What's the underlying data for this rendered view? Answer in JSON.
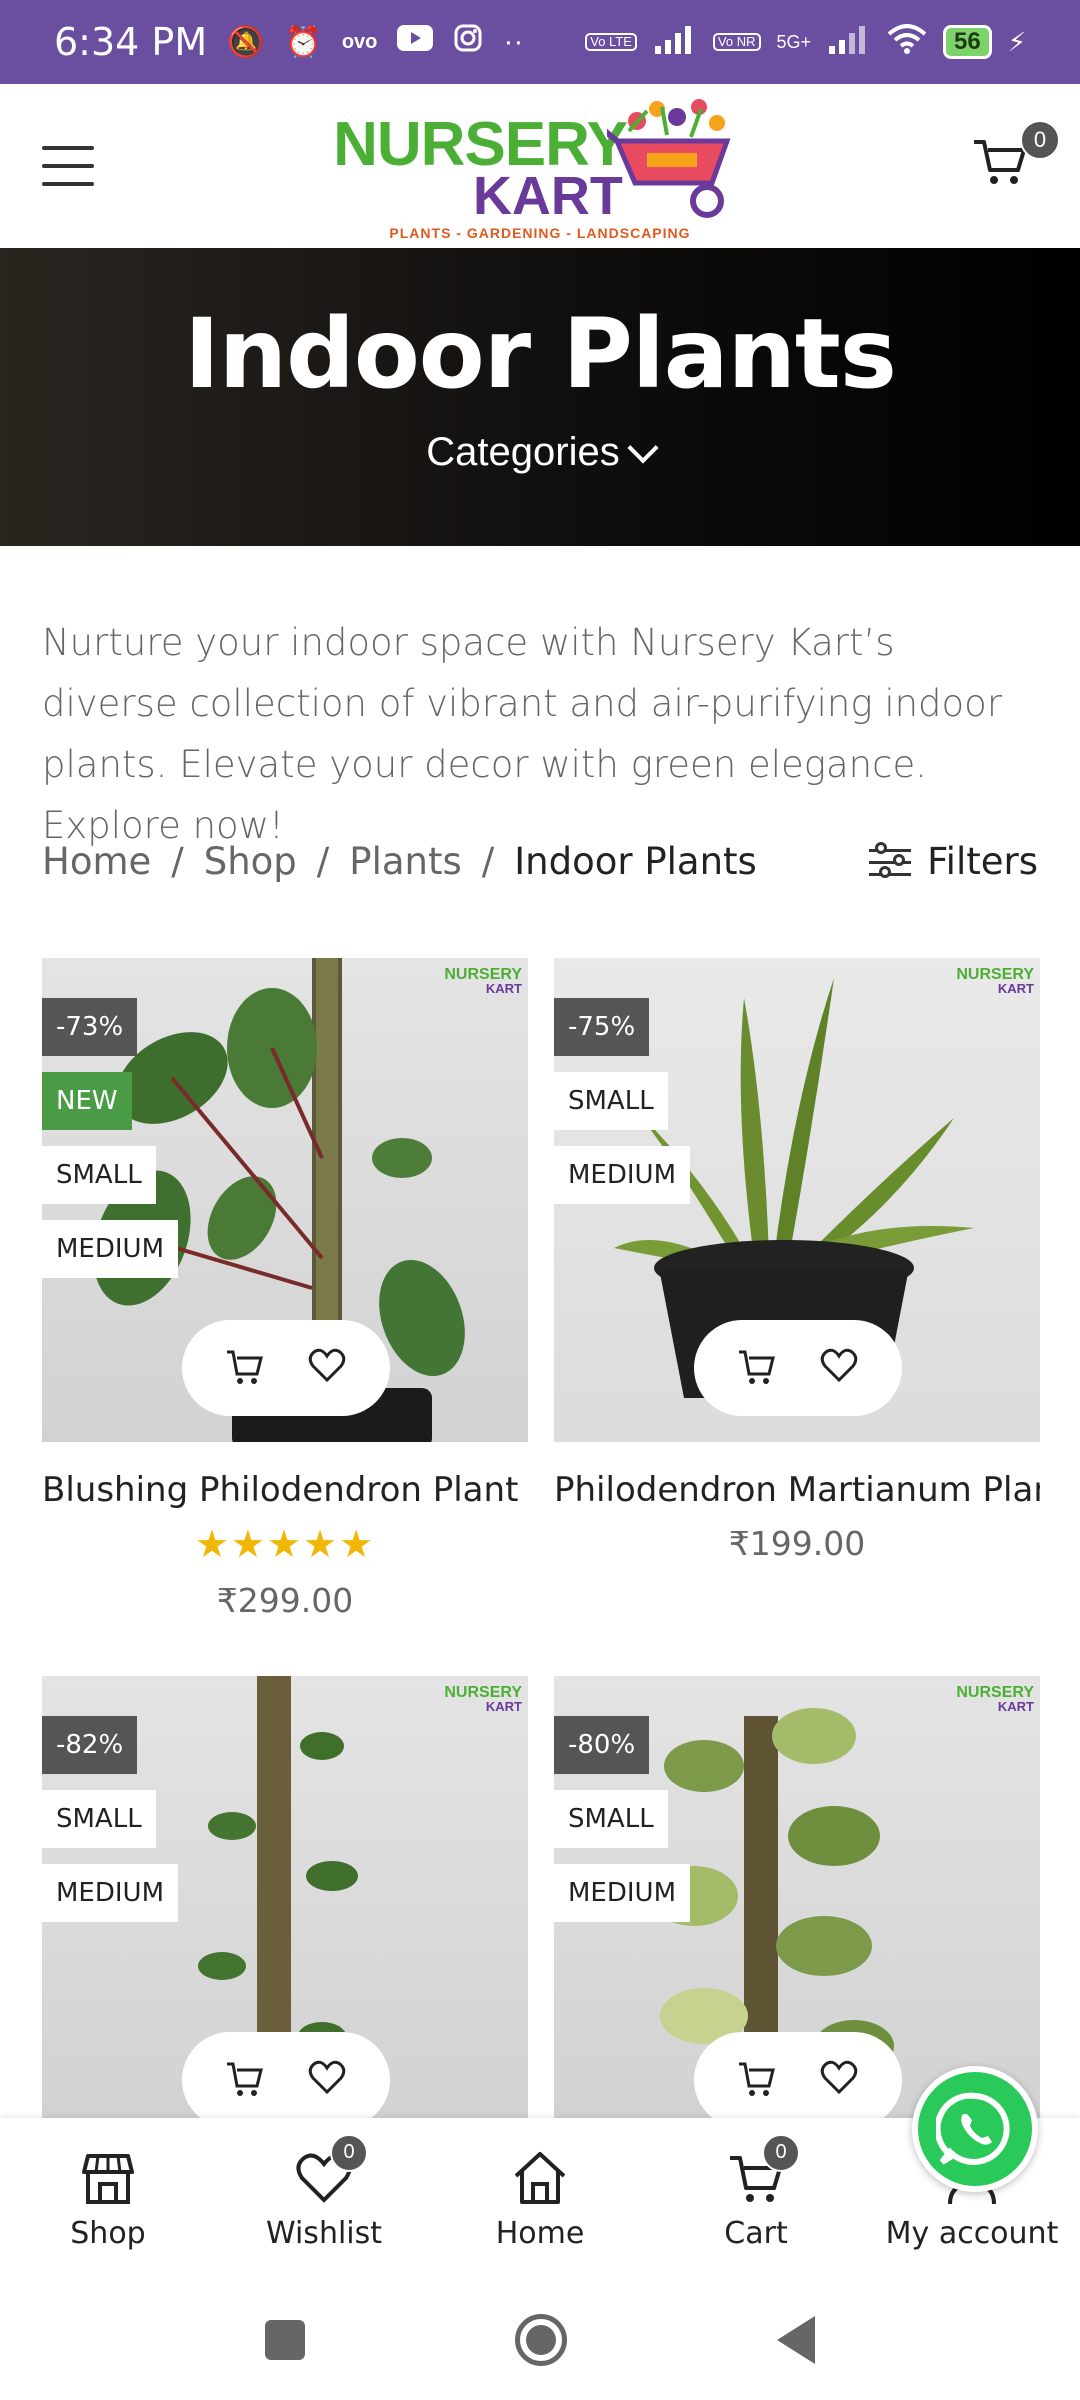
{
  "status_bar": {
    "time": "6:34 PM",
    "extra_dots": "··",
    "vo_lte": "Vo LTE",
    "vo_nr": "Vo NR",
    "network": "5G+",
    "battery": "56"
  },
  "header": {
    "logo": {
      "line1": "NURSERY",
      "line2": "KART",
      "tagline": "PLANTS - GARDENING - LANDSCAPING"
    },
    "cart_count": "0"
  },
  "banner": {
    "title": "Indoor Plants",
    "categories_label": "Categories"
  },
  "description": "Nurture your indoor space with Nursery Kart’s diverse collection of vibrant and air-purifying indoor plants. Elevate your decor with green elegance. Explore now!",
  "breadcrumb": {
    "items": [
      "Home",
      "Shop",
      "Plants"
    ],
    "separator": "/",
    "current": "Indoor Plants"
  },
  "filters_label": "Filters",
  "watermark": {
    "line1": "NURSERY",
    "line2": "KART"
  },
  "products": [
    {
      "discount": "-73%",
      "new_label": "NEW",
      "sizes": [
        "SMALL",
        "MEDIUM"
      ],
      "title": "Blushing Philodendron Plant –",
      "rating": "★★★★★",
      "price": "₹299.00"
    },
    {
      "discount": "-75%",
      "sizes": [
        "SMALL",
        "MEDIUM"
      ],
      "title": "Philodendron Martianum Plant",
      "price": "₹199.00"
    },
    {
      "discount": "-82%",
      "sizes": [
        "SMALL",
        "MEDIUM"
      ]
    },
    {
      "discount": "-80%",
      "sizes": [
        "SMALL",
        "MEDIUM"
      ]
    }
  ],
  "bottom_nav": {
    "items": [
      {
        "label": "Shop",
        "icon": "shop-icon"
      },
      {
        "label": "Wishlist",
        "icon": "heart-icon",
        "badge": "0"
      },
      {
        "label": "Home",
        "icon": "home-icon"
      },
      {
        "label": "Cart",
        "icon": "cart-icon",
        "badge": "0"
      },
      {
        "label": "My account",
        "icon": "user-icon"
      }
    ]
  },
  "colors": {
    "status_bar": "#6a4fa0",
    "brand_green": "#4caf35",
    "brand_purple": "#6a3a9a",
    "new_badge": "#4a9b45",
    "star": "#f2b705",
    "whatsapp": "#29c95a"
  }
}
